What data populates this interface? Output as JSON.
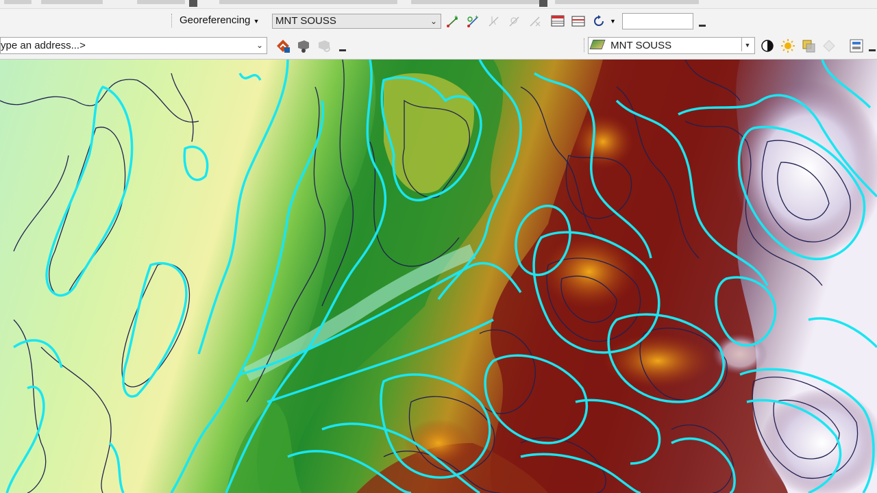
{
  "toolbar": {
    "georeferencing_label": "Georeferencing",
    "georef_layer_value": "MNT SOUSS",
    "scale_value": "",
    "address_placeholder": "ype an address...>",
    "layer_value": "MNT SOUSS"
  },
  "icons": {
    "add_control_points": "add-control-points-icon",
    "auto_add_links": "auto-add-links-icon",
    "select_link": "select-link-icon",
    "zoom_to_link": "zoom-to-link-icon",
    "delete_link": "delete-link-icon",
    "view_table": "view-link-table-icon",
    "rotate": "rotate-icon",
    "contrast": "contrast-icon",
    "brightness": "brightness-icon",
    "transparency": "transparency-icon",
    "effects": "effects-icon"
  },
  "colors": {
    "contour_major": "#19e6f2",
    "contour_minor": "#20204a",
    "lowland": "#c8f2b4",
    "forest": "#1e8a2a",
    "upland": "#d8a022",
    "highland": "#7a1410",
    "summit": "#f4f0fa"
  }
}
